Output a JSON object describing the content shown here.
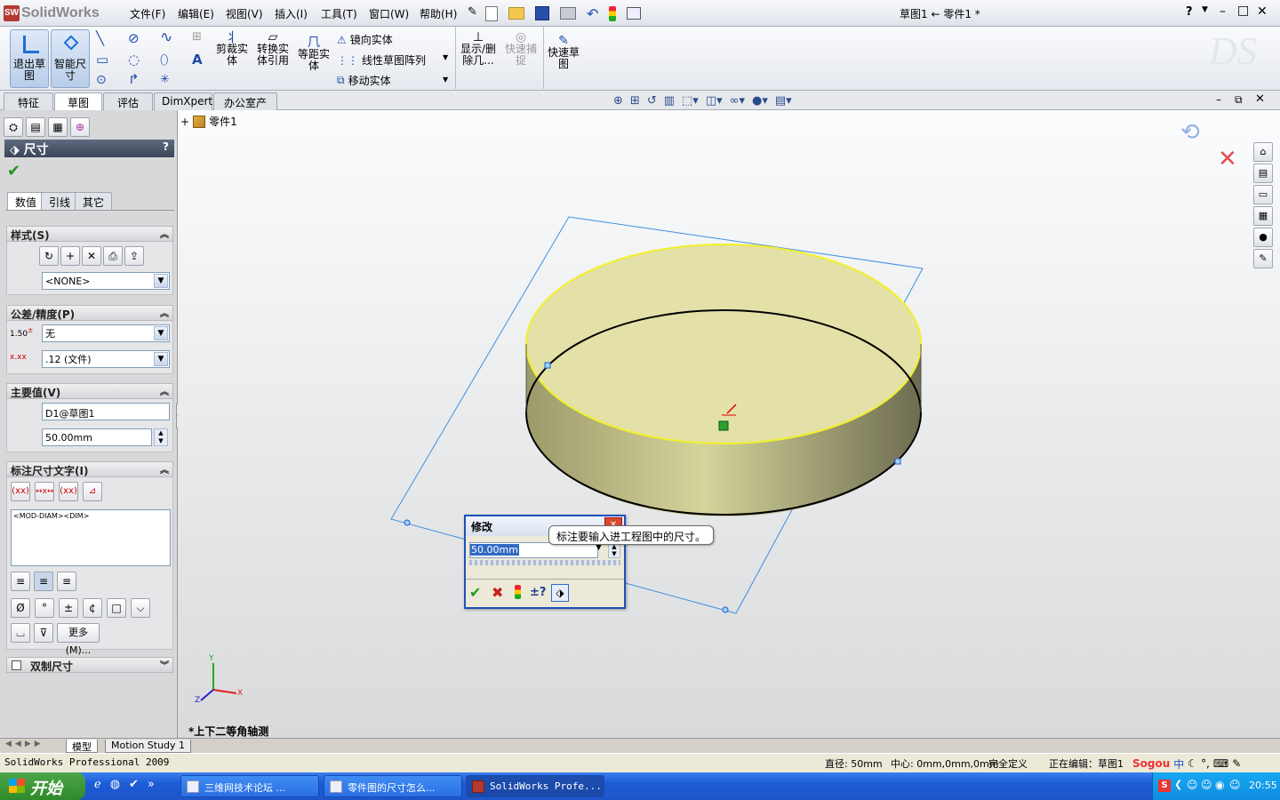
{
  "app": {
    "logo_text": "SolidWorks",
    "doc_title": "草图1 ← 零件1 *"
  },
  "menu": [
    "文件(F)",
    "编辑(E)",
    "视图(V)",
    "插入(I)",
    "工具(T)",
    "窗口(W)",
    "帮助(H)"
  ],
  "window_controls": {
    "help": "?",
    "minimize": "–",
    "restore": "□",
    "close": "✕"
  },
  "command_manager": {
    "exit_sketch": "退出草图",
    "smart_dim": "智能尺寸",
    "trim": "剪裁实体",
    "convert": "转换实体引用",
    "offset": "等距实体",
    "mirror": "镜向实体",
    "linear_pattern": "线性草图阵列",
    "move": "移动实体",
    "display_delete": "显示/删除几...",
    "quick_snap": "快速捕捉",
    "rapid_sketch": "快速草图"
  },
  "cm_tabs": [
    "特征",
    "草图",
    "评估",
    "DimXpert",
    "办公室产品"
  ],
  "cm_active_tab": "草图",
  "tree": {
    "part": "零件1",
    "expand": "+"
  },
  "panel": {
    "title": "尺寸",
    "help": "?",
    "subtabs": [
      "数值",
      "引线",
      "其它"
    ],
    "style": {
      "header": "样式(S)",
      "combo": "<NONE>"
    },
    "tolerance": {
      "header": "公差/精度(P)",
      "tol_label": "1.50",
      "tol_combo": "无",
      "prec_combo": ".12 (文件)"
    },
    "primary": {
      "header": "主要值(V)",
      "name": "D1@草图1",
      "value": "50.00mm"
    },
    "dim_text": {
      "header": "标注尺寸文字(I)",
      "content": "<MOD-DIAM><DIM>"
    },
    "symbols": [
      "Ø",
      "°",
      "±",
      "¢",
      "□",
      "⌵",
      "⌴",
      "⊽"
    ],
    "more_btn": "更多(M)...",
    "dual": {
      "header": "双制尺寸"
    }
  },
  "modify_dialog": {
    "title": "修改",
    "value": "50.00mm",
    "pm": "±?"
  },
  "tooltip": "标注要输入进工程图中的尺寸。",
  "view_label": "*上下二等角轴测",
  "axes": {
    "x": "X",
    "y": "Y",
    "z": "Z"
  },
  "bottom_tabs": [
    "模型",
    "Motion Study 1"
  ],
  "status": {
    "product": "SolidWorks Professional 2009",
    "diameter": "直径: 50mm",
    "center": "中心: 0mm,0mm,0mm",
    "defined": "完全定义",
    "editing": "正在编辑：草图1"
  },
  "taskbar": {
    "start": "开始",
    "tasks": [
      "三维网技术论坛 ...",
      "零件图的尺寸怎么...",
      "SolidWorks Profe..."
    ],
    "ime": "Sogou",
    "ime_mode": "中",
    "clock": "20:55"
  },
  "colors": {
    "top_face": "#e8e6a2",
    "side_face": "#c9c891",
    "selected_edge": "#f2f02a",
    "sketch_line": "#3f8fe0",
    "accent": "#1f50b8"
  }
}
